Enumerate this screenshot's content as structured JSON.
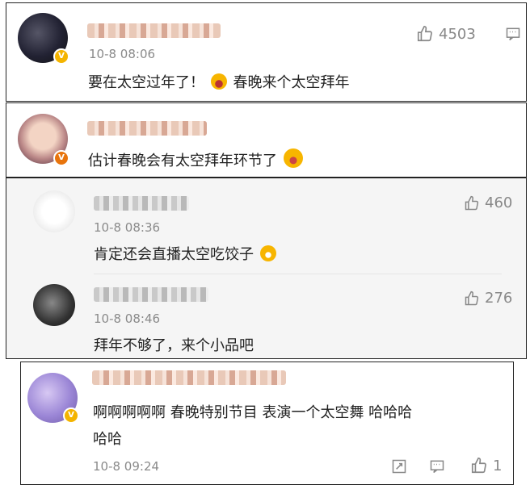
{
  "comments": [
    {
      "time": "10-8 08:06",
      "text_a": "要在太空过年了！",
      "text_b": "春晚来个太空拜年",
      "likes": "4503",
      "emoji_icon": "laughing-face-icon"
    },
    {
      "text": "估计春晚会有太空拜年环节了",
      "emoji_icon": "screaming-face-icon"
    }
  ],
  "replies": [
    {
      "time": "10-8 08:36",
      "text": "肯定还会直播太空吃饺子",
      "likes": "460",
      "emoji_icon": "grinning-face-icon"
    },
    {
      "time": "10-8 08:46",
      "text": "拜年不够了，来个小品吧",
      "likes": "276"
    }
  ],
  "last_comment": {
    "text_line1": "啊啊啊啊啊 春晚特别节目 表演一个太空舞 哈哈哈",
    "text_line2": "哈哈",
    "time": "10-8 09:24",
    "likes": "1"
  },
  "colors": {
    "badge": "#f4b400",
    "text": "#222222",
    "meta": "#8a8a8a"
  }
}
